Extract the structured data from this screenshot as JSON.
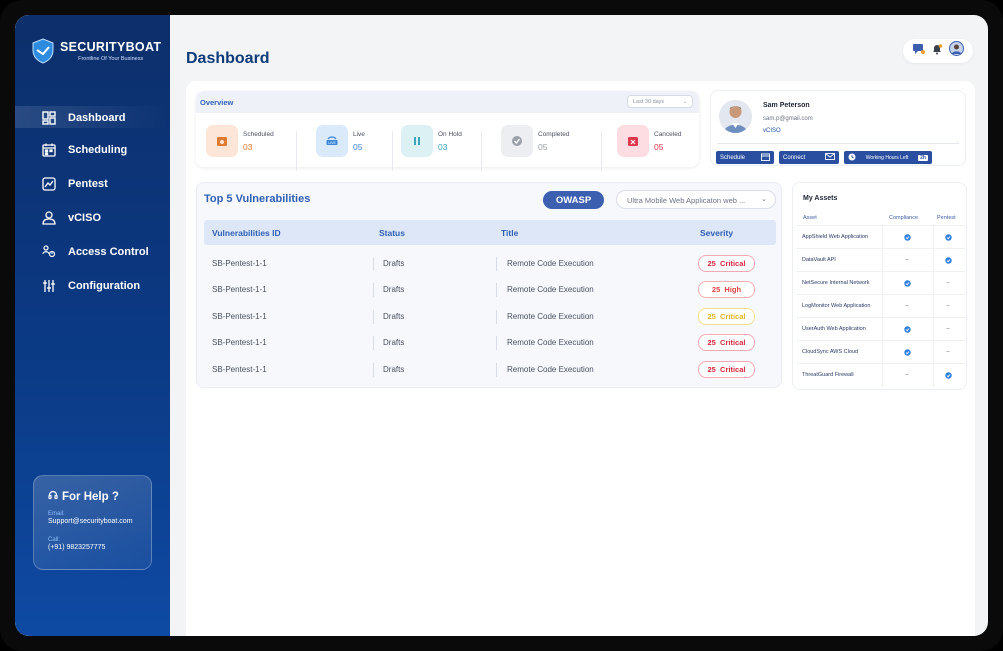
{
  "brand": {
    "name": "SECURITYBOAT",
    "tagline": "Frontline Of Your Business"
  },
  "nav": [
    {
      "label": "Dashboard",
      "icon": "dashboard-grid-icon",
      "active": true
    },
    {
      "label": "Scheduling",
      "icon": "calendar-icon"
    },
    {
      "label": "Pentest",
      "icon": "chart-icon"
    },
    {
      "label": "vCISO",
      "icon": "user-icon"
    },
    {
      "label": "Access Control",
      "icon": "access-control-icon"
    },
    {
      "label": "Configuration",
      "icon": "sliders-icon"
    }
  ],
  "help": {
    "title": "For Help ?",
    "email_label": "Email:",
    "email": "Support@securityboat.com",
    "call_label": "Call:",
    "phone": "(+91) 9823257775"
  },
  "page_title": "Dashboard",
  "overview": {
    "title": "Overview",
    "range": "Last 30 days",
    "stats": [
      {
        "label": "Scheduled",
        "value": "03",
        "color": "#e07a2e",
        "bg": "#fde6d8"
      },
      {
        "label": "Live",
        "value": "05",
        "color": "#3a86d8",
        "bg": "#dbeafb"
      },
      {
        "label": "On Hold",
        "value": "03",
        "color": "#3aa6b8",
        "bg": "#dcf1f4"
      },
      {
        "label": "Completed",
        "value": "05",
        "color": "#9aa0aa",
        "bg": "#eceef1"
      },
      {
        "label": "Canceled",
        "value": "05",
        "color": "#e0354a",
        "bg": "#fddde2"
      }
    ]
  },
  "profile": {
    "name": "Sam Peterson",
    "email": "sam.p@gmail.com",
    "role": "vCISO",
    "schedule_label": "Schedule",
    "connect_label": "Connect",
    "hours_label": "Working Hours Left",
    "hours_value": "2h"
  },
  "vulnerabilities": {
    "title": "Top 5 Vulnerabilities",
    "owasp_label": "OWASP",
    "app_select": "Ultra Mobile Web Applicaton web ...",
    "headers": [
      "Vulnerabilities ID",
      "Status",
      "Title",
      "Severity"
    ],
    "rows": [
      {
        "id": "SB-Pentest-1-1",
        "status": "Drafts",
        "title": "Remote Code Execution",
        "score": "25",
        "severity": "Critical",
        "color": "#d8283e",
        "border": "#f3a8b2"
      },
      {
        "id": "SB-Pentest-1-1",
        "status": "Drafts",
        "title": "Remote Code Execution",
        "score": "25",
        "severity": "High",
        "color": "#e04040",
        "border": "#f3b0b0"
      },
      {
        "id": "SB-Pentest-1-1",
        "status": "Drafts",
        "title": "Remote Code Execution",
        "score": "25",
        "severity": "Critical",
        "color": "#e0b520",
        "border": "#f4e08a"
      },
      {
        "id": "SB-Pentest-1-1",
        "status": "Drafts",
        "title": "Remote Code Execution",
        "score": "25",
        "severity": "Critical",
        "color": "#d8283e",
        "border": "#f3a8b2"
      },
      {
        "id": "SB-Pentest-1-1",
        "status": "Drafts",
        "title": "Remote Code Execution",
        "score": "25",
        "severity": "Critical",
        "color": "#d8283e",
        "border": "#f3a8b2"
      }
    ]
  },
  "assets": {
    "title": "My Assets",
    "headers": [
      "Asset",
      "Compliance",
      "Pentest"
    ],
    "rows": [
      {
        "name": "AppShield Web Application",
        "compliance": true,
        "pentest": true
      },
      {
        "name": "DataVault API",
        "compliance": false,
        "pentest": true
      },
      {
        "name": "NetSecure Internal Network",
        "compliance": true,
        "pentest": false
      },
      {
        "name": "LogMonitor Web Application",
        "compliance": false,
        "pentest": false
      },
      {
        "name": "UserAuth Web Application",
        "compliance": true,
        "pentest": false
      },
      {
        "name": "CloudSync AWS Cloud",
        "compliance": true,
        "pentest": false
      },
      {
        "name": "ThreatGuard Firewall",
        "compliance": false,
        "pentest": true
      }
    ],
    "empty_mark": "–"
  }
}
